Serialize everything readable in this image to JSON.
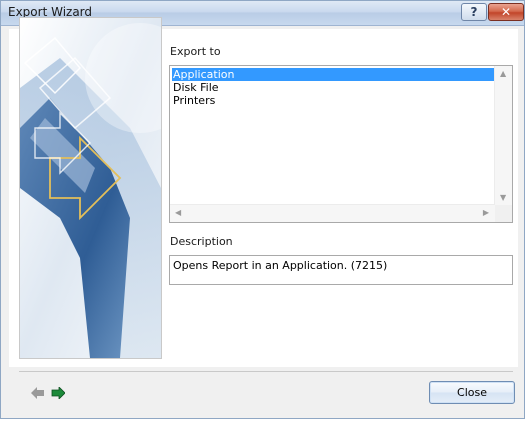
{
  "window": {
    "title": "Export Wizard",
    "help_button": "?",
    "close_button": "✕"
  },
  "export": {
    "label": "Export to",
    "items": [
      {
        "label": "Application",
        "selected": true
      },
      {
        "label": "Disk File",
        "selected": false
      },
      {
        "label": "Printers",
        "selected": false
      }
    ]
  },
  "description": {
    "label": "Description",
    "text": "Opens Report in an Application. (7215)"
  },
  "footer": {
    "back_icon": "arrow-left-icon",
    "forward_icon": "arrow-right-icon",
    "close_label": "Close"
  },
  "colors": {
    "selection": "#3399ff",
    "forward_arrow": "#1c8a3a",
    "back_arrow": "#9a9a9a"
  }
}
